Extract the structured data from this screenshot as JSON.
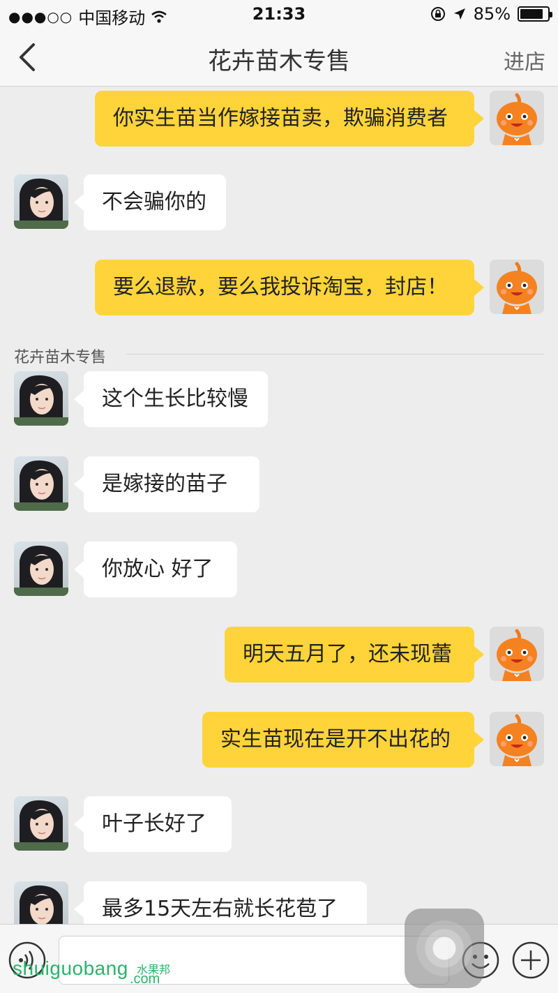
{
  "status_bar": {
    "signal": "●●●○○",
    "carrier": "中国移动",
    "time": "21:33",
    "battery_pct_text": "85%",
    "battery_level": 0.85
  },
  "nav": {
    "back_icon": "chevron-left-icon",
    "title": "花卉苗木专售",
    "action": "进店"
  },
  "chat": {
    "sender_label": "花卉苗木专售",
    "messages": [
      {
        "side": "out",
        "text": "你实生苗当作嫁接苗卖，欺骗消费者"
      },
      {
        "side": "in",
        "text": "不会骗你的"
      },
      {
        "side": "out",
        "text": "要么退款，要么我投诉淘宝，封店！"
      },
      {
        "side": "in",
        "text": "这个生长比较慢"
      },
      {
        "side": "in",
        "text": " 是嫁接的苗子"
      },
      {
        "side": "in",
        "text": "你放心 好了"
      },
      {
        "side": "out",
        "text": "明天五月了，还未现蕾"
      },
      {
        "side": "out",
        "text": "实生苗现在是开不出花的"
      },
      {
        "side": "in",
        "text": "叶子长好了"
      },
      {
        "side": "in",
        "text": " 最多15天左右就长花苞了"
      }
    ]
  },
  "input_bar": {
    "voice_icon": "voice-icon",
    "emoji_icon": "emoji-icon",
    "plus_icon": "plus-icon",
    "input_value": ""
  },
  "watermark": {
    "text": "shuiguobang",
    "cn": "水果邦",
    "com": ".com"
  },
  "colors": {
    "outgoing_bubble": "#ffd43a",
    "incoming_bubble": "#ffffff",
    "background": "#ededed",
    "watermark": "#2bb36b"
  }
}
